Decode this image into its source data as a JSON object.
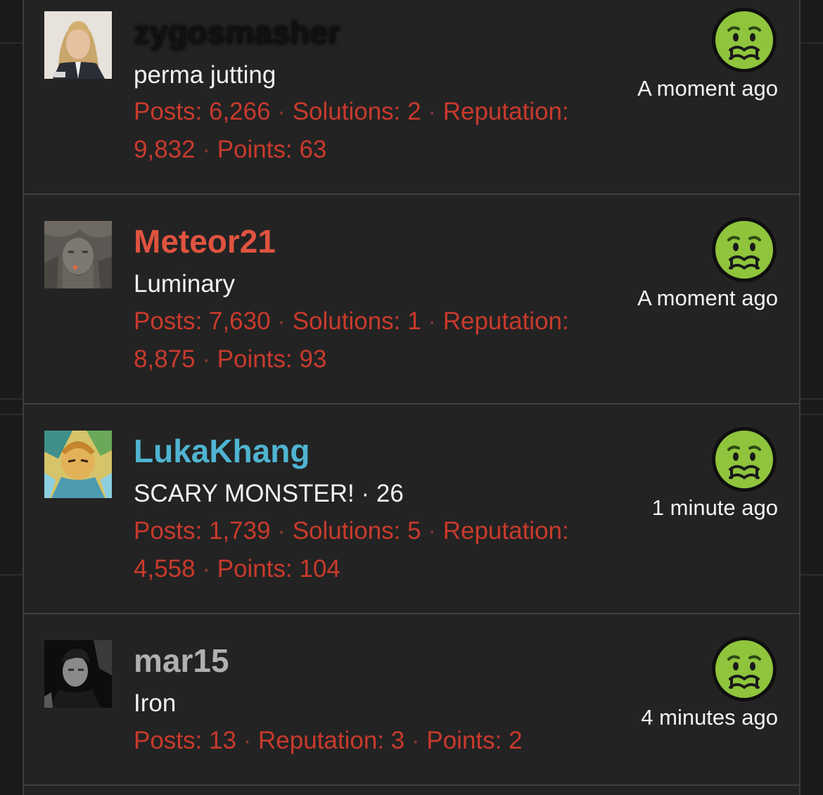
{
  "colors": {
    "background": "#1a1a1a",
    "panel": "#232323",
    "stat_text": "#c93a2c",
    "username_dark": "#111111",
    "username_red": "#e0533f",
    "username_blue": "#4fb4d1",
    "username_gray": "#b0b0b0",
    "emoji_face": "#8fc43c"
  },
  "reaction_icon": "nauseated-face-icon",
  "posts": [
    {
      "username": "zygosmasher",
      "rank": "perma jutting",
      "stats_line1": [
        {
          "label": "Posts: ",
          "value": "6,266"
        },
        {
          "label": "Solutions: ",
          "value": "2"
        },
        {
          "label": "Reputation:",
          "value": ""
        }
      ],
      "stats_line2": [
        {
          "label": "",
          "value": "9,832"
        },
        {
          "label": "Points: ",
          "value": "63"
        }
      ],
      "time": "A moment ago"
    },
    {
      "username": "Meteor21",
      "rank": "Luminary",
      "stats_line1": [
        {
          "label": "Posts: ",
          "value": "7,630"
        },
        {
          "label": "Solutions: ",
          "value": "1"
        },
        {
          "label": "Reputation:",
          "value": ""
        }
      ],
      "stats_line2": [
        {
          "label": "",
          "value": "8,875"
        },
        {
          "label": "Points: ",
          "value": "93"
        }
      ],
      "time": "A moment ago"
    },
    {
      "username": "LukaKhang",
      "rank": "SCARY MONSTER! · 26",
      "stats_line1": [
        {
          "label": "Posts: ",
          "value": "1,739"
        },
        {
          "label": "Solutions: ",
          "value": "5"
        },
        {
          "label": "Reputation:",
          "value": ""
        }
      ],
      "stats_line2": [
        {
          "label": "",
          "value": "4,558"
        },
        {
          "label": "Points: ",
          "value": "104"
        }
      ],
      "time": "1 minute ago"
    },
    {
      "username": "mar15",
      "rank": "Iron",
      "stats_line1": [
        {
          "label": "Posts: ",
          "value": "13"
        },
        {
          "label": "Reputation: ",
          "value": "3"
        },
        {
          "label": "Points: ",
          "value": "2"
        }
      ],
      "stats_line2": [],
      "time": "4 minutes ago"
    }
  ]
}
